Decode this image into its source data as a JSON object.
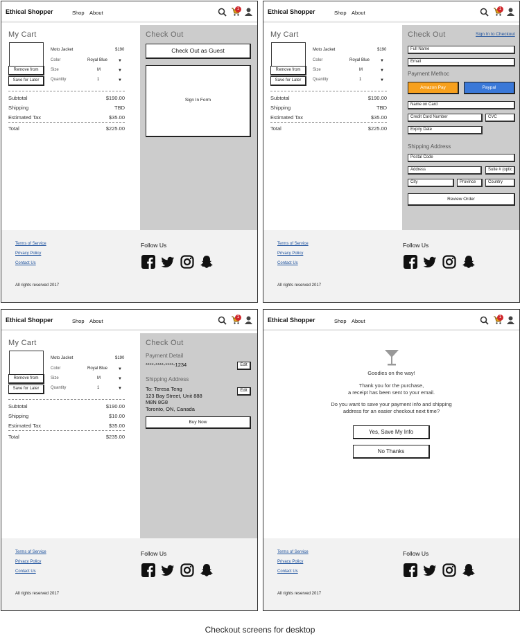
{
  "header": {
    "brand": "Ethical Shopper",
    "nav_shop": "Shop",
    "nav_about": "About",
    "cart_count": "1"
  },
  "cart": {
    "title": "My Cart",
    "product_name": "Moto Jacket",
    "product_price": "$190",
    "color_label": "Color",
    "color_value": "Royal Blue",
    "size_label": "Size",
    "size_value": "M",
    "quantity_label": "Quantity",
    "quantity_value": "1",
    "remove_label": "Remove from",
    "save_label": "Save for Later",
    "subtotal_label": "Subtotal",
    "shipping_label": "Shipping",
    "tax_label": "Estimated Tax",
    "total_label": "Total"
  },
  "cart_totals_1": {
    "subtotal": "$190.00",
    "shipping": "TBD",
    "tax": "$35.00",
    "total": "$225.00"
  },
  "cart_totals_3": {
    "subtotal": "$190.00",
    "shipping": "$10.00",
    "tax": "$35.00",
    "total": "$235.00"
  },
  "checkout": {
    "title": "Check Out",
    "guest_button": "Check Out as Guest",
    "signin_form": "Sign In Form",
    "signin_link": "Sign In to Checkout",
    "full_name": "Full Name",
    "email": "Email",
    "payment_method": "Payment Methoc",
    "amazon_pay": "Amazon Pay",
    "paypal": "Paypal",
    "name_on_card": "Name on Card",
    "card_number": "Credit Card Number",
    "cvc": "CVC",
    "expiry": "Expiry Date",
    "shipping_address": "Shipping Address",
    "postal_code": "Postal Code",
    "address": "Address",
    "suite": "Suite # (optic",
    "city": "City",
    "province": "Province",
    "country": "Country",
    "review_order": "Review Order"
  },
  "review": {
    "payment_detail": "Payment Detail",
    "card_masked": "****-****-****-1234",
    "edit": "Edit",
    "shipping_address": "Shipping Address",
    "addr_line1": "To: Teresa Teng",
    "addr_line2": "123 Bay Street, Unit 888",
    "addr_line3": "M8N 8G8",
    "addr_line4": "Toronto, ON, Canada",
    "buy_now": "Buy Now"
  },
  "confirmation": {
    "goodies": "Goodies on the way!",
    "thanks_line1": "Thank you for the purchase,",
    "thanks_line2": "a receipt has been sent to your email.",
    "question_line1": "Do you want to save your payment info and shipping",
    "question_line2": "address for an easier checkout next time?",
    "yes_button": "Yes, Save My Info",
    "no_button": "No Thanks"
  },
  "footer": {
    "terms": "Terms of Service",
    "privacy": "Privacy Policy",
    "contact": "Contact Us",
    "follow": "Follow Us",
    "rights": "All rights reserved 2017"
  },
  "colors": {
    "amazon": "#f7a01d",
    "paypal": "#3a78d8",
    "badge": "#d0282c",
    "link": "#1a4f9c",
    "panel": "#cccccc"
  },
  "caption": "Checkout screens for desktop"
}
